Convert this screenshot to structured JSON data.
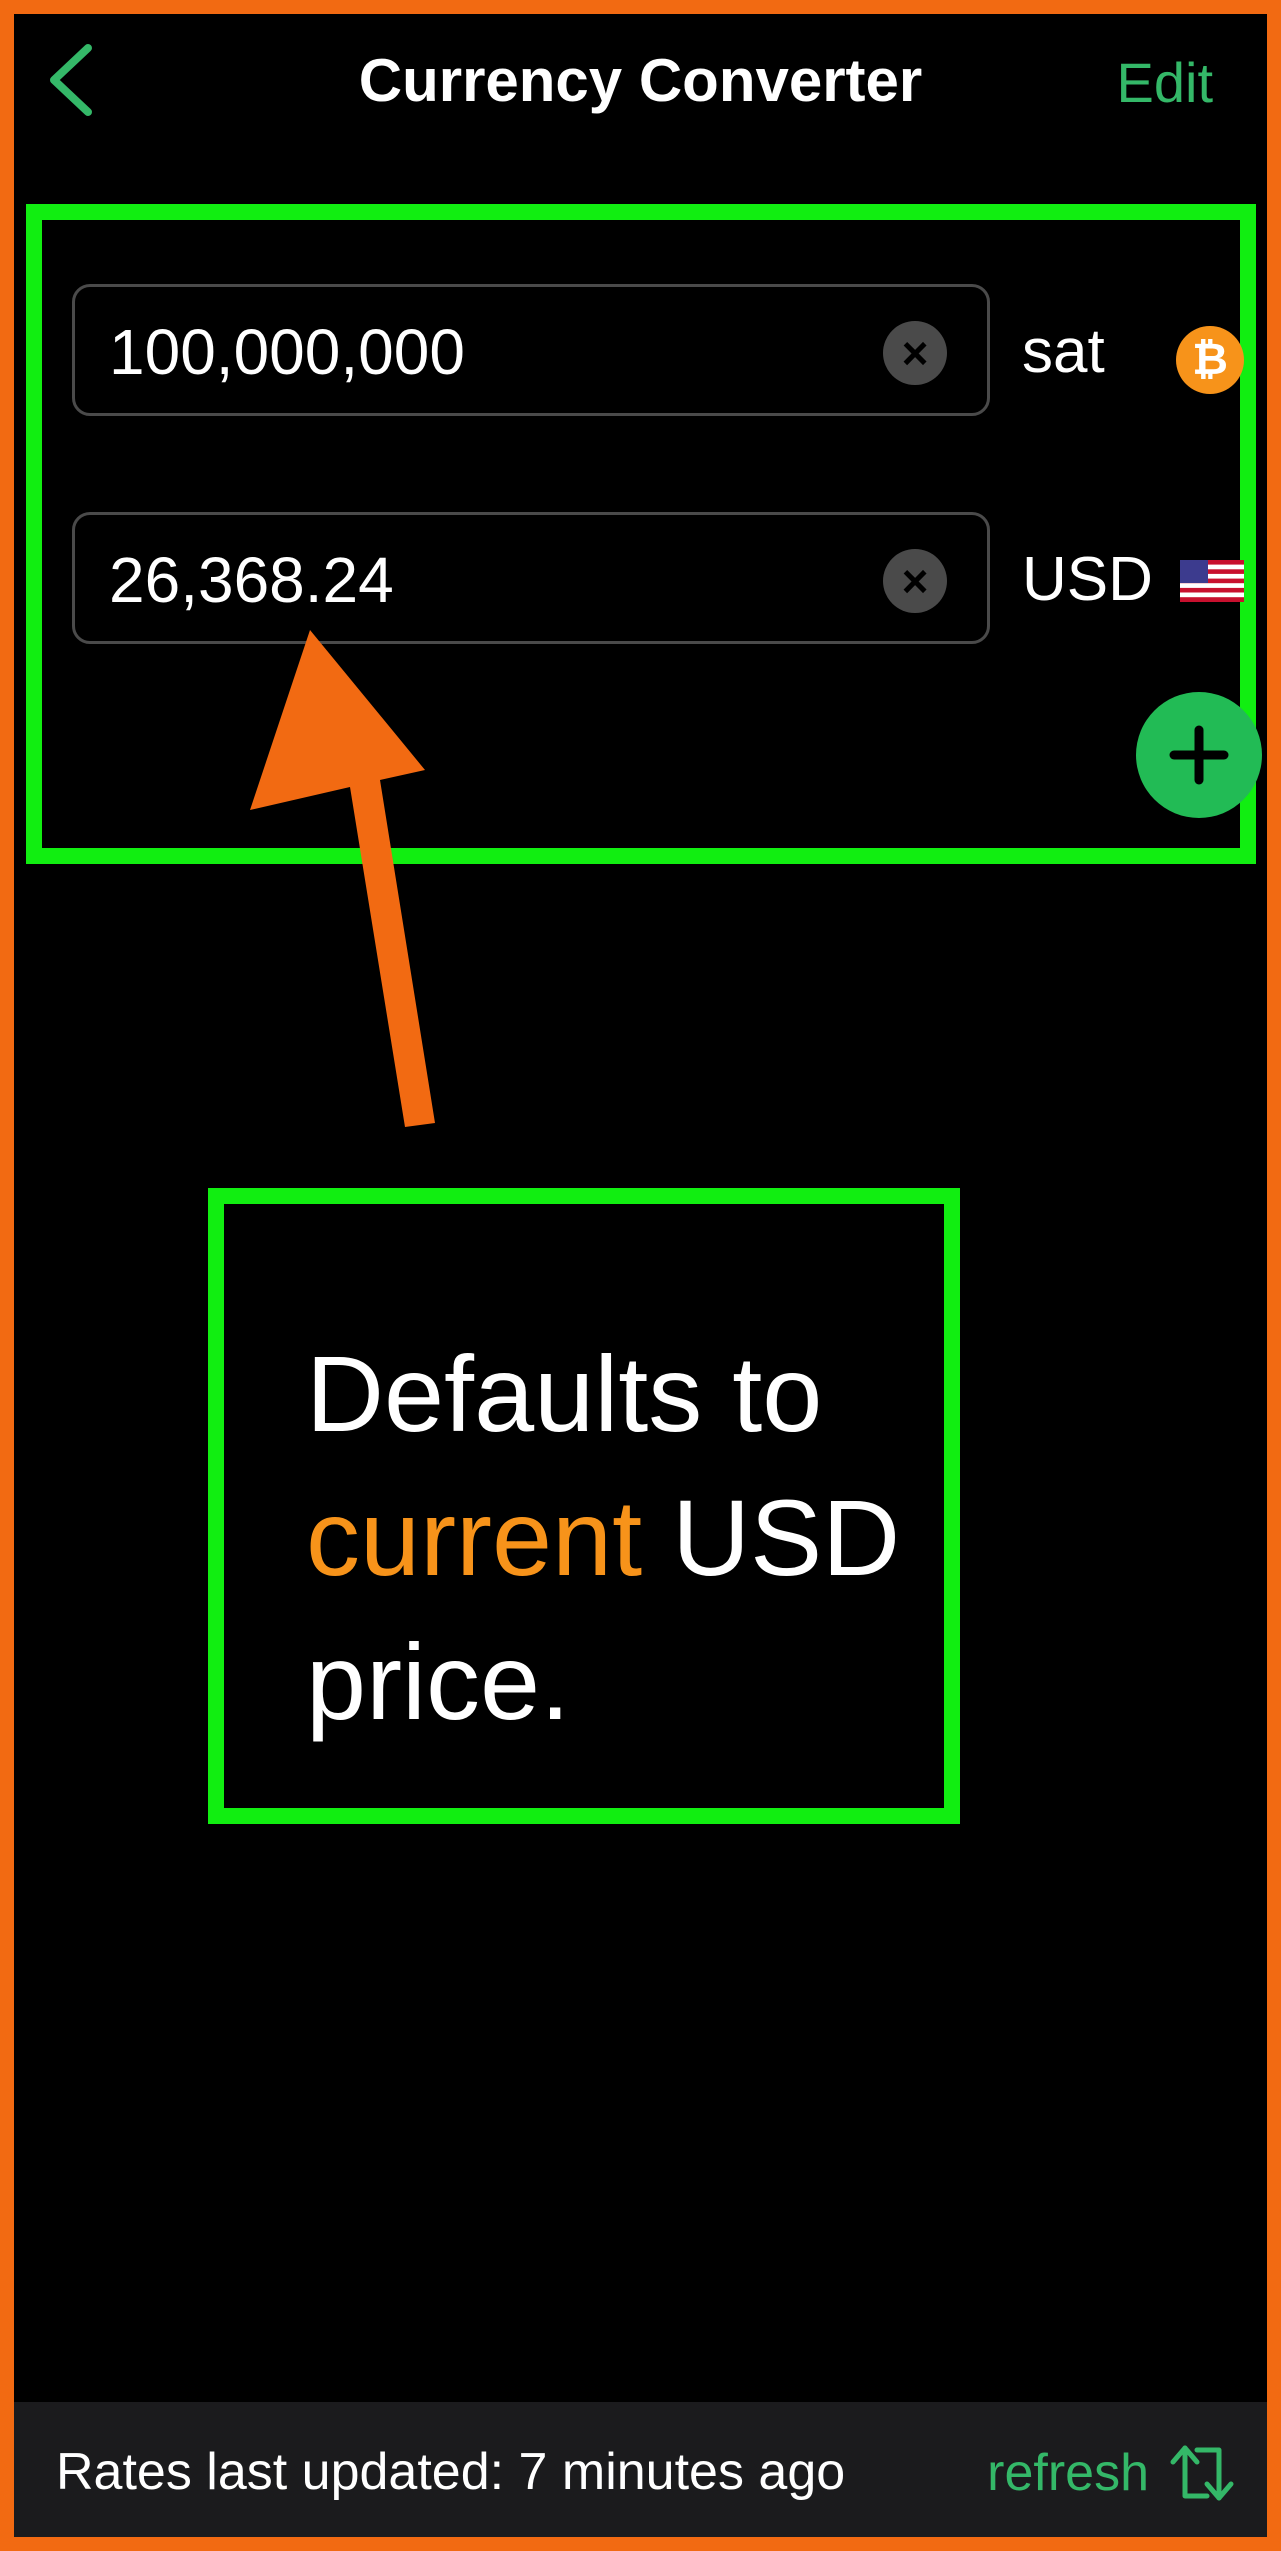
{
  "nav": {
    "title": "Currency Converter",
    "edit_label": "Edit",
    "back_icon": "chevron-left-icon"
  },
  "converter": {
    "rows": [
      {
        "value": "100,000,000",
        "unit": "sat",
        "icon": "bitcoin-icon"
      },
      {
        "value": "26,368.24",
        "unit": "USD",
        "icon": "us-flag-icon"
      }
    ],
    "btc_symbol": "₿",
    "clear_symbol": "×",
    "add_icon": "plus-icon"
  },
  "annotation": {
    "line1": "Defaults to",
    "highlight": "current",
    "line2_rest": " USD",
    "line3": "price."
  },
  "footer": {
    "status": "Rates last updated: 7 minutes ago",
    "refresh_label": "refresh",
    "refresh_icon": "refresh-icon"
  },
  "colors": {
    "accent_green": "#34b868",
    "highlight_green": "#11ee11",
    "frame_orange": "#f26a12",
    "bitcoin_orange": "#f7931a"
  }
}
